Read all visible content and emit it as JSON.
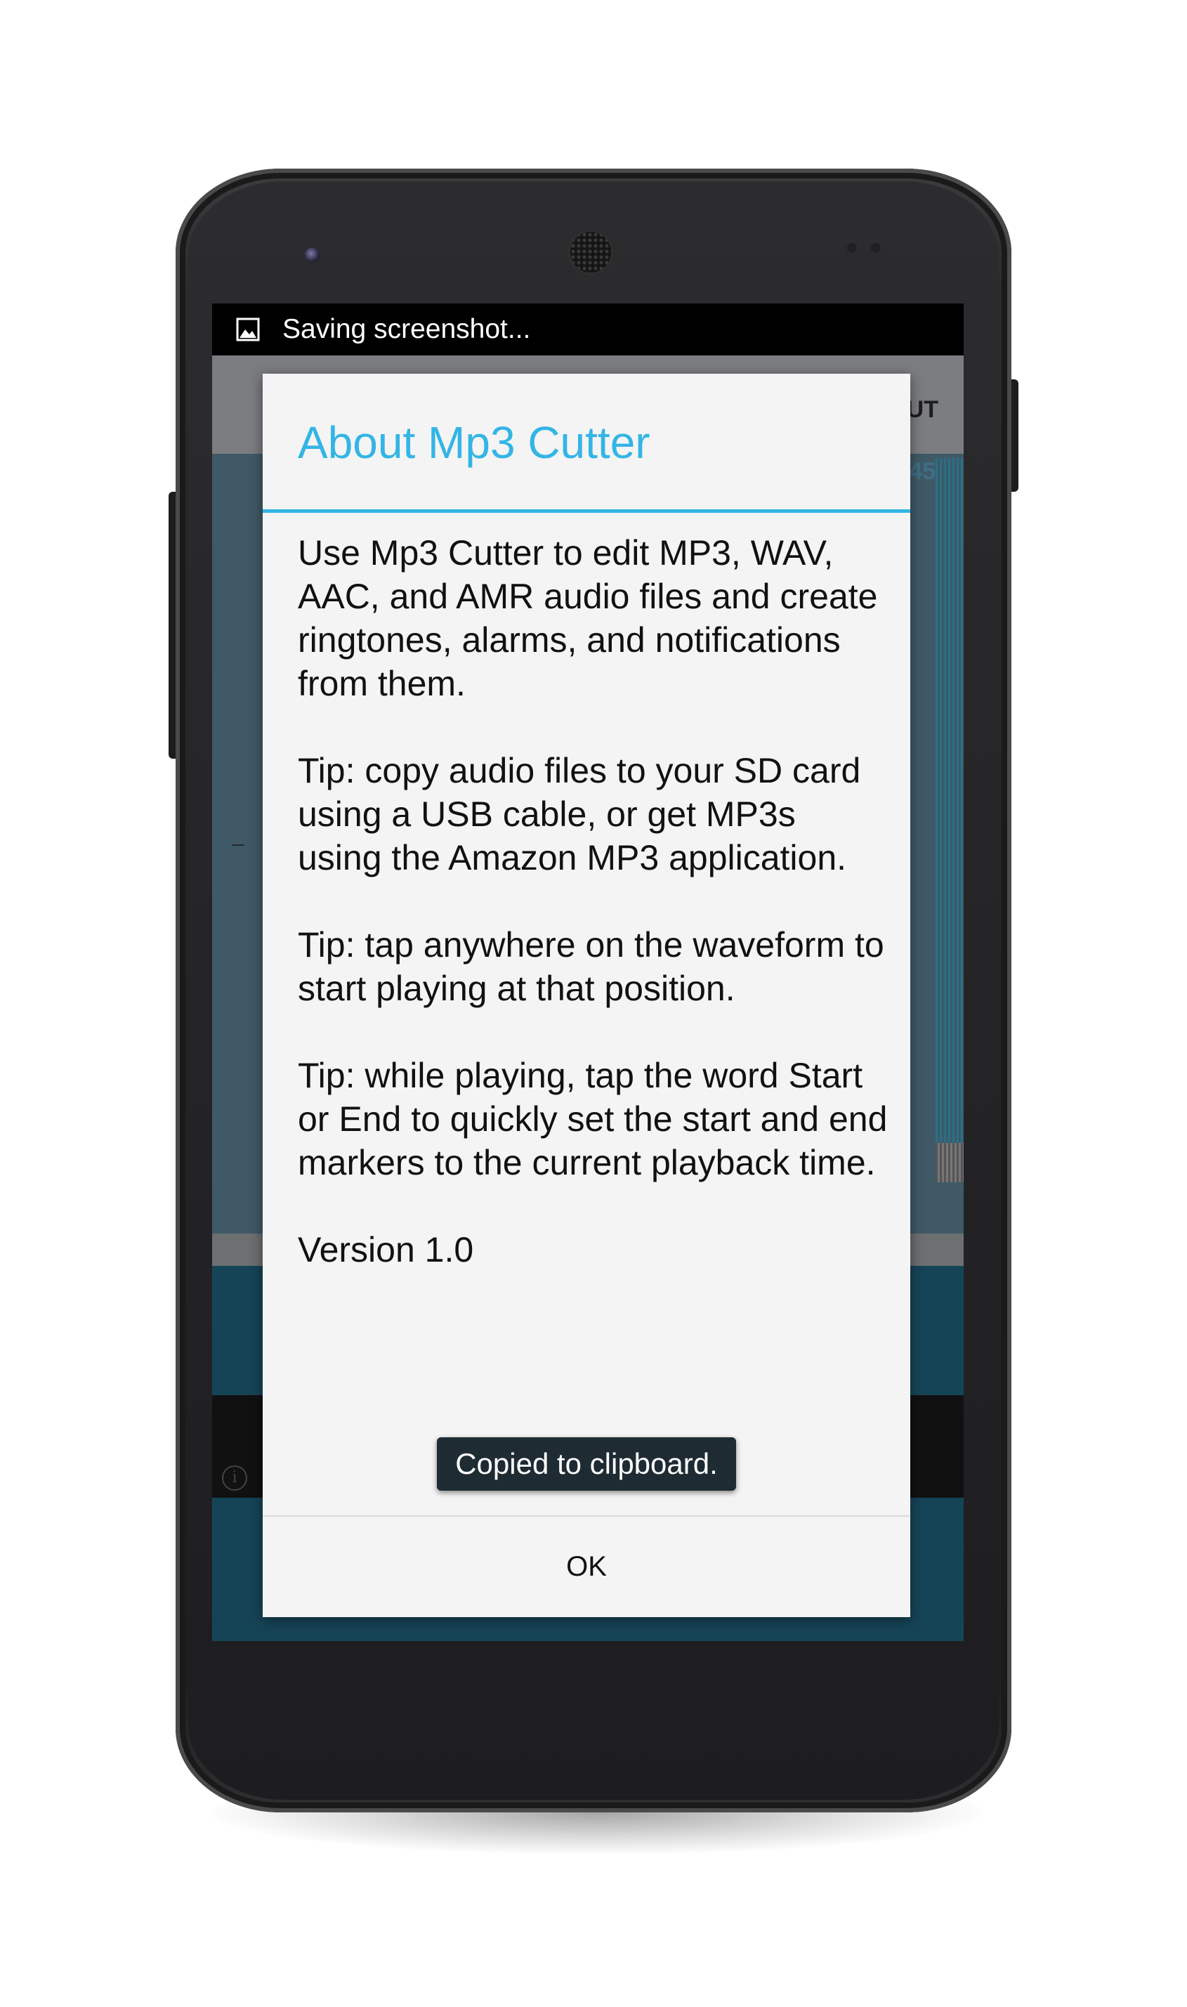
{
  "status_bar": {
    "notification_icon": "image-icon",
    "text": "Saving screenshot..."
  },
  "background_app": {
    "actionbar_label_partial": "UT",
    "time_label_partial": "45",
    "ad_info_icon": "info-icon",
    "colors": {
      "waveform_background": "#3f5a66",
      "controls_blue": "#164457"
    }
  },
  "dialog": {
    "title": "About Mp3 Cutter",
    "paragraphs": [
      "Use Mp3 Cutter to edit MP3, WAV, AAC, and AMR audio files and create ringtones, alarms, and notifications from them.",
      "Tip: copy audio files to your SD card using a USB cable, or get MP3s using the Amazon MP3 application.",
      "Tip: tap anywhere on the waveform to start playing at that position.",
      "Tip: while playing, tap the word Start or End to quickly set the start and end markers to the current playback time."
    ],
    "version": "Version 1.0",
    "ok_label": "OK",
    "colors": {
      "accent": "#33b5e5",
      "background": "#f4f4f4"
    }
  },
  "toast": {
    "text": "Copied to clipboard."
  }
}
